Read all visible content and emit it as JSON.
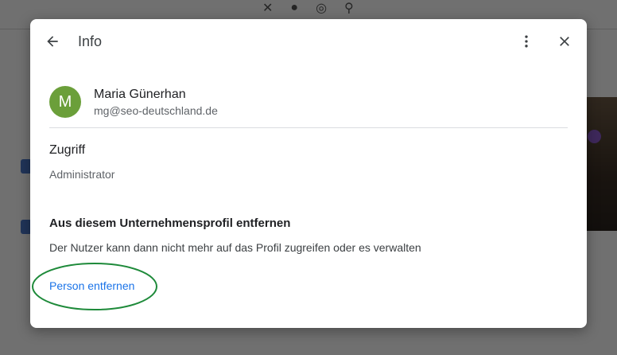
{
  "dialog": {
    "title": "Info",
    "back_icon": "arrow-back-icon",
    "more_icon": "more-vert-icon",
    "close_icon": "close-icon"
  },
  "user": {
    "avatar_initial": "M",
    "avatar_color": "#6b9f3a",
    "name": "Maria Günerhan",
    "email": "mg@seo-deutschland.de"
  },
  "access": {
    "heading": "Zugriff",
    "role": "Administrator"
  },
  "remove": {
    "heading": "Aus diesem Unternehmensprofil entfernen",
    "description": "Der Nutzer kann dann nicht mehr auf das Profil zugreifen oder es verwalten",
    "link_label": "Person entfernen",
    "link_color": "#1a73e8"
  },
  "annotation": {
    "ellipse_color": "#1e8a3a"
  }
}
